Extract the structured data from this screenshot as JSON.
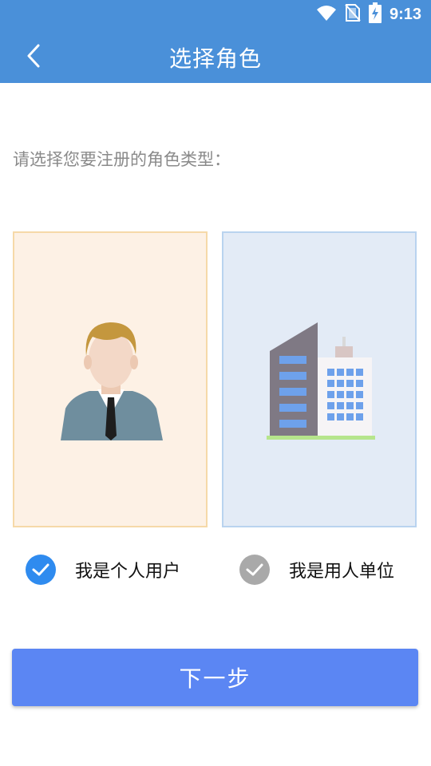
{
  "status_bar": {
    "time": "9:13",
    "icons": [
      "wifi-icon",
      "no-sim-icon",
      "battery-charging-icon"
    ]
  },
  "header": {
    "title": "选择角色",
    "back_icon": "chevron-left-icon",
    "background_color": "#4a90d9"
  },
  "main": {
    "prompt": "请选择您要注册的角色类型：",
    "cards": [
      {
        "role": "individual",
        "illustration": "person-icon"
      },
      {
        "role": "employer",
        "illustration": "building-icon"
      }
    ],
    "options": [
      {
        "label": "我是个人用户",
        "checked": true
      },
      {
        "label": "我是用人单位",
        "checked": false
      }
    ],
    "next_button": "下一步"
  },
  "colors": {
    "accent": "#5b86f3",
    "checked": "#2f8bef",
    "unchecked": "#a9a9a9"
  }
}
